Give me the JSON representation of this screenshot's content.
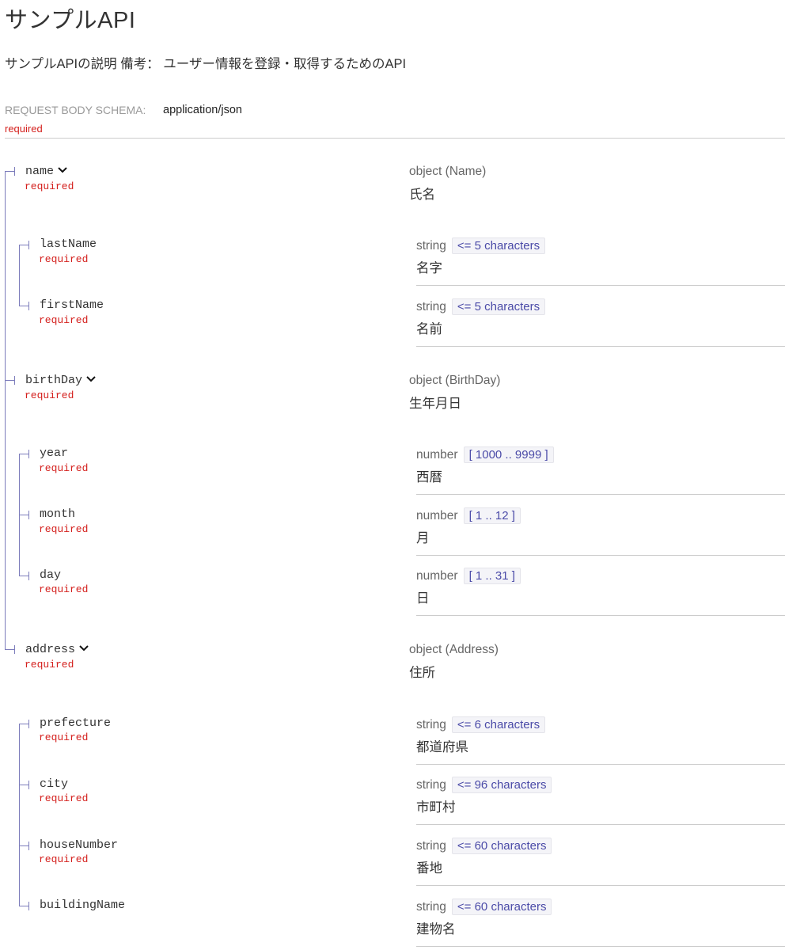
{
  "header": {
    "title": "サンプルAPI",
    "description": "サンプルAPIの説明 備考： ユーザー情報を登録・取得するためのAPI"
  },
  "request_body": {
    "label": "REQUEST BODY SCHEMA:",
    "content_type": "application/json",
    "required": "required"
  },
  "fields": {
    "name": {
      "label": "name",
      "required": "required",
      "type": "object (Name)",
      "description": "氏名"
    },
    "lastName": {
      "label": "lastName",
      "required": "required",
      "type": "string",
      "constraint": "<= 5 characters",
      "description": "名字"
    },
    "firstName": {
      "label": "firstName",
      "required": "required",
      "type": "string",
      "constraint": "<= 5 characters",
      "description": "名前"
    },
    "birthDay": {
      "label": "birthDay",
      "required": "required",
      "type": "object (BirthDay)",
      "description": "生年月日"
    },
    "year": {
      "label": "year",
      "required": "required",
      "type": "number",
      "constraint": "[ 1000 .. 9999 ]",
      "description": "西暦"
    },
    "month": {
      "label": "month",
      "required": "required",
      "type": "number",
      "constraint": "[ 1 .. 12 ]",
      "description": "月"
    },
    "day": {
      "label": "day",
      "required": "required",
      "type": "number",
      "constraint": "[ 1 .. 31 ]",
      "description": "日"
    },
    "address": {
      "label": "address",
      "required": "required",
      "type": "object (Address)",
      "description": "住所"
    },
    "prefecture": {
      "label": "prefecture",
      "required": "required",
      "type": "string",
      "constraint": "<= 6 characters",
      "description": "都道府県"
    },
    "city": {
      "label": "city",
      "required": "required",
      "type": "string",
      "constraint": "<= 96 characters",
      "description": "市町村"
    },
    "houseNumber": {
      "label": "houseNumber",
      "required": "required",
      "type": "string",
      "constraint": "<= 60 characters",
      "description": "番地"
    },
    "buildingName": {
      "label": "buildingName",
      "type": "string",
      "constraint": "<= 60 characters",
      "description": "建物名"
    }
  },
  "icons": {
    "expand": "chevron-down-icon"
  },
  "colors": {
    "required": "#d41f1c",
    "tree_line": "#7c7cbb",
    "badge_text": "#4b4ba8"
  }
}
